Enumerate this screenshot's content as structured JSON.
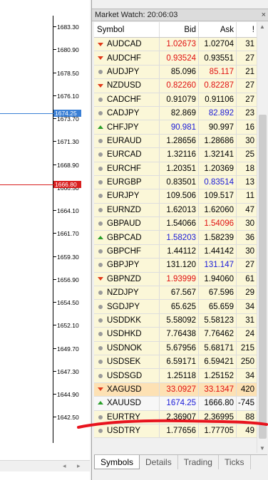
{
  "market_watch": {
    "title": "Market Watch: 20:06:03",
    "columns": {
      "symbol": "Symbol",
      "bid": "Bid",
      "ask": "Ask",
      "spread": "!"
    },
    "rows": [
      {
        "symbol": "AUDCAD",
        "icon": "down-arrow-icon",
        "bid": "1.02673",
        "ask": "1.02704",
        "spread": "31",
        "bid_color": "red",
        "ask_color": "black"
      },
      {
        "symbol": "AUDCHF",
        "icon": "down-arrow-icon",
        "bid": "0.93524",
        "ask": "0.93551",
        "spread": "27",
        "bid_color": "red",
        "ask_color": "black"
      },
      {
        "symbol": "AUDJPY",
        "icon": "neutral-dot-icon",
        "bid": "85.096",
        "ask": "85.117",
        "spread": "21",
        "bid_color": "black",
        "ask_color": "red"
      },
      {
        "symbol": "NZDUSD",
        "icon": "down-arrow-icon",
        "bid": "0.82260",
        "ask": "0.82287",
        "spread": "27",
        "bid_color": "red",
        "ask_color": "red"
      },
      {
        "symbol": "CADCHF",
        "icon": "neutral-dot-icon",
        "bid": "0.91079",
        "ask": "0.91106",
        "spread": "27",
        "bid_color": "black",
        "ask_color": "black"
      },
      {
        "symbol": "CADJPY",
        "icon": "neutral-dot-icon",
        "bid": "82.869",
        "ask": "82.892",
        "spread": "23",
        "bid_color": "black",
        "ask_color": "blue"
      },
      {
        "symbol": "CHFJPY",
        "icon": "up-arrow-icon",
        "bid": "90.981",
        "ask": "90.997",
        "spread": "16",
        "bid_color": "blue",
        "ask_color": "black"
      },
      {
        "symbol": "EURAUD",
        "icon": "neutral-dot-icon",
        "bid": "1.28656",
        "ask": "1.28686",
        "spread": "30",
        "bid_color": "black",
        "ask_color": "black"
      },
      {
        "symbol": "EURCAD",
        "icon": "neutral-dot-icon",
        "bid": "1.32116",
        "ask": "1.32141",
        "spread": "25",
        "bid_color": "black",
        "ask_color": "black"
      },
      {
        "symbol": "EURCHF",
        "icon": "neutral-dot-icon",
        "bid": "1.20351",
        "ask": "1.20369",
        "spread": "18",
        "bid_color": "black",
        "ask_color": "black"
      },
      {
        "symbol": "EURGBP",
        "icon": "neutral-dot-icon",
        "bid": "0.83501",
        "ask": "0.83514",
        "spread": "13",
        "bid_color": "black",
        "ask_color": "blue"
      },
      {
        "symbol": "EURJPY",
        "icon": "neutral-dot-icon",
        "bid": "109.506",
        "ask": "109.517",
        "spread": "11",
        "bid_color": "black",
        "ask_color": "black"
      },
      {
        "symbol": "EURNZD",
        "icon": "neutral-dot-icon",
        "bid": "1.62013",
        "ask": "1.62060",
        "spread": "47",
        "bid_color": "black",
        "ask_color": "black"
      },
      {
        "symbol": "GBPAUD",
        "icon": "neutral-dot-icon",
        "bid": "1.54066",
        "ask": "1.54096",
        "spread": "30",
        "bid_color": "black",
        "ask_color": "red"
      },
      {
        "symbol": "GBPCAD",
        "icon": "up-arrow-icon",
        "bid": "1.58203",
        "ask": "1.58239",
        "spread": "36",
        "bid_color": "blue",
        "ask_color": "black"
      },
      {
        "symbol": "GBPCHF",
        "icon": "neutral-dot-icon",
        "bid": "1.44112",
        "ask": "1.44142",
        "spread": "30",
        "bid_color": "black",
        "ask_color": "black"
      },
      {
        "symbol": "GBPJPY",
        "icon": "neutral-dot-icon",
        "bid": "131.120",
        "ask": "131.147",
        "spread": "27",
        "bid_color": "black",
        "ask_color": "blue"
      },
      {
        "symbol": "GBPNZD",
        "icon": "down-arrow-icon",
        "bid": "1.93999",
        "ask": "1.94060",
        "spread": "61",
        "bid_color": "red",
        "ask_color": "black"
      },
      {
        "symbol": "NZDJPY",
        "icon": "neutral-dot-icon",
        "bid": "67.567",
        "ask": "67.596",
        "spread": "29",
        "bid_color": "black",
        "ask_color": "black"
      },
      {
        "symbol": "SGDJPY",
        "icon": "neutral-dot-icon",
        "bid": "65.625",
        "ask": "65.659",
        "spread": "34",
        "bid_color": "black",
        "ask_color": "black"
      },
      {
        "symbol": "USDDKK",
        "icon": "neutral-dot-icon",
        "bid": "5.58092",
        "ask": "5.58123",
        "spread": "31",
        "bid_color": "black",
        "ask_color": "black"
      },
      {
        "symbol": "USDHKD",
        "icon": "neutral-dot-icon",
        "bid": "7.76438",
        "ask": "7.76462",
        "spread": "24",
        "bid_color": "black",
        "ask_color": "black"
      },
      {
        "symbol": "USDNOK",
        "icon": "neutral-dot-icon",
        "bid": "5.67956",
        "ask": "5.68171",
        "spread": "215",
        "bid_color": "black",
        "ask_color": "black"
      },
      {
        "symbol": "USDSEK",
        "icon": "neutral-dot-icon",
        "bid": "6.59171",
        "ask": "6.59421",
        "spread": "250",
        "bid_color": "black",
        "ask_color": "black"
      },
      {
        "symbol": "USDSGD",
        "icon": "neutral-dot-icon",
        "bid": "1.25118",
        "ask": "1.25152",
        "spread": "34",
        "bid_color": "black",
        "ask_color": "black"
      },
      {
        "symbol": "XAGUSD",
        "icon": "down-arrow-icon",
        "bid": "33.0927",
        "ask": "33.1347",
        "spread": "420",
        "bid_color": "red",
        "ask_color": "red",
        "highlight": "sell"
      },
      {
        "symbol": "XAUUSD",
        "icon": "up-arrow-icon",
        "bid": "1674.25",
        "ask": "1666.80",
        "spread": "-745",
        "bid_color": "blue",
        "ask_color": "black",
        "highlight": "buy"
      },
      {
        "symbol": "EURTRY",
        "icon": "neutral-dot-icon",
        "bid": "2.36907",
        "ask": "2.36995",
        "spread": "88",
        "bid_color": "black",
        "ask_color": "black"
      },
      {
        "symbol": "USDTRY",
        "icon": "neutral-dot-icon",
        "bid": "1.77656",
        "ask": "1.77705",
        "spread": "49",
        "bid_color": "black",
        "ask_color": "black"
      }
    ],
    "tabs": [
      {
        "label": "Symbols",
        "active": true
      },
      {
        "label": "Details",
        "active": false
      },
      {
        "label": "Trading",
        "active": false
      },
      {
        "label": "Ticks",
        "active": false
      }
    ]
  },
  "chart": {
    "price_axis": [
      "1683.30",
      "1680.90",
      "1678.50",
      "1676.10",
      "1673.70",
      "1671.30",
      "1668.90",
      "1666.50",
      "1664.10",
      "1661.70",
      "1659.30",
      "1656.90",
      "1654.50",
      "1652.10",
      "1649.70",
      "1647.30",
      "1644.90",
      "1642.50"
    ],
    "bid_line": {
      "price": "1674.25",
      "color": "#3a7fd5"
    },
    "ask_line": {
      "price": "1666.80",
      "color": "#d81e1e"
    }
  },
  "colors": {
    "blue": "#1a1ad8",
    "red": "#e01010",
    "row_bg": "#fbf7d8",
    "accent_sell": "#fde1b4",
    "annotation": "#e8141e"
  }
}
